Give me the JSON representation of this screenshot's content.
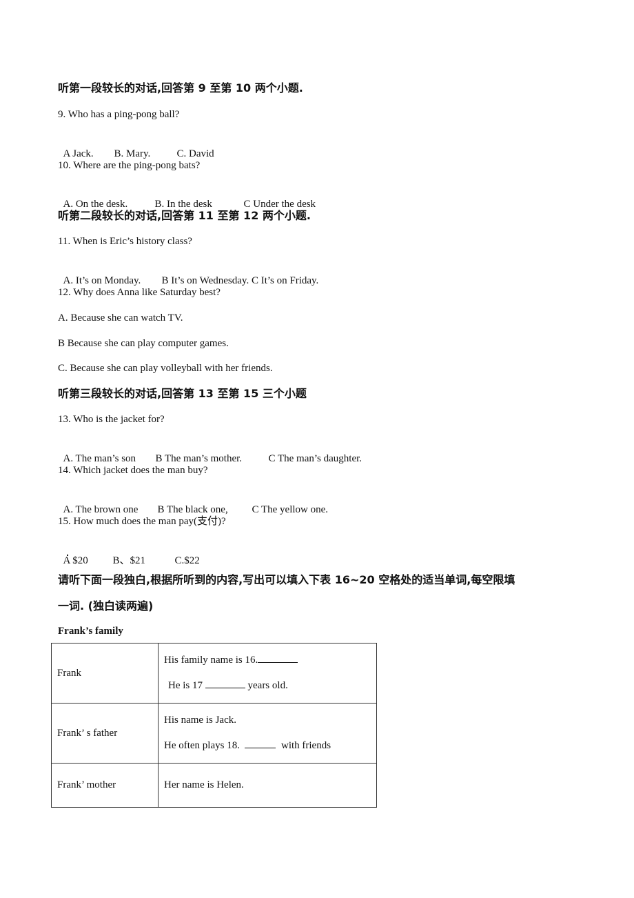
{
  "sections": [
    {
      "heading": "听第一段较长的对话,回答第 9 至第 10 两个小题.",
      "questions": [
        {
          "text": "9. Who has a ping-pong ball?",
          "options": [
            "A Jack.",
            "B. Mary.",
            "C. David"
          ]
        },
        {
          "text": "10. Where are the ping-pong bats?",
          "options": [
            "A. On the desk.",
            "B. In the desk",
            "C Under the desk"
          ]
        }
      ]
    },
    {
      "heading": "听第二段较长的对话,回答第 11 至第 12 两个小题.",
      "questions": [
        {
          "text": "11. When is Eric’s history class?",
          "options": [
            "A. It’s on Monday.",
            "B It’s on Wednesday. C It’s on Friday."
          ]
        },
        {
          "text": "12. Why does Anna like Saturday best?",
          "options": [
            "A. Because she can watch TV.",
            "B Because she can play computer games.",
            "C. Because she can play volleyball with her friends."
          ]
        }
      ]
    },
    {
      "heading": "听第三段较长的对话,回答第 13 至第 15 三个小题",
      "questions": [
        {
          "text": "13. Who is the jacket for?",
          "options": [
            "A. The man’s son",
            "B The man’s mother.",
            "C The man’s daughter."
          ]
        },
        {
          "text": "14. Which jacket does the man buy?",
          "options": [
            "A. The brown one",
            "B The black one,",
            "C The yellow one."
          ]
        },
        {
          "text": "15. How much does the man pay(支付)?",
          "options": [
            "A $20",
            "B、$21",
            "C.$22"
          ]
        }
      ]
    }
  ],
  "monologue": {
    "instruction_line1": "请听下面一段独白,根据所听到的内容,写出可以填入下表 16~20 空格处的适当单词,每空限填",
    "instruction_line2": "一词. (独白读两遍)",
    "table_title": "Frank’s family",
    "rows": [
      {
        "label": "Frank",
        "lines": [
          "His family name is 16.",
          "He is 17",
          "years old."
        ]
      },
      {
        "label": "Frank’ s father",
        "lines": [
          "His name is Jack.",
          "He often plays 18.",
          "with friends"
        ]
      },
      {
        "label": "Frank’ mother",
        "lines": [
          "Her name is Helen."
        ]
      }
    ]
  }
}
